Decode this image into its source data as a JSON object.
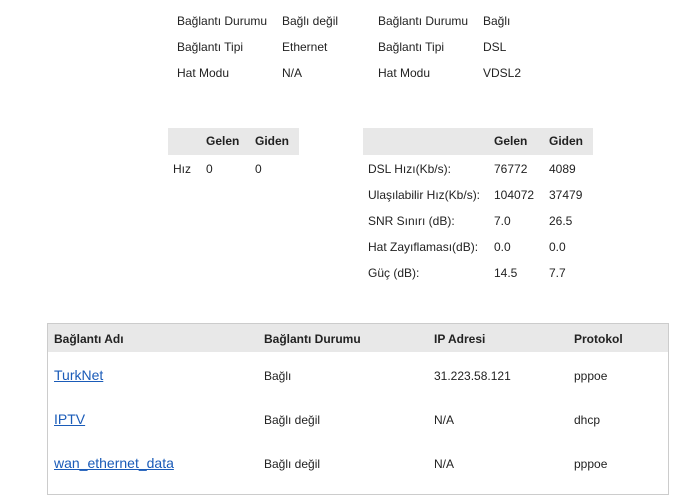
{
  "dsl_status": {
    "left": [
      {
        "label": "Bağlantı Durumu",
        "value": "Bağlı değil"
      },
      {
        "label": "Bağlantı Tipi",
        "value": "Ethernet"
      },
      {
        "label": "Hat Modu",
        "value": "N/A"
      }
    ],
    "right": [
      {
        "label": "Bağlantı Durumu",
        "value": "Bağlı"
      },
      {
        "label": "Bağlantı Tipi",
        "value": "DSL"
      },
      {
        "label": "Hat Modu",
        "value": "VDSL2"
      }
    ]
  },
  "speed_left": {
    "headers": [
      "Gelen",
      "Giden"
    ],
    "rows": [
      {
        "label": "Hız",
        "in": "0",
        "out": "0"
      }
    ]
  },
  "speed_right": {
    "headers": [
      "Gelen",
      "Giden"
    ],
    "rows": [
      {
        "label": "DSL Hızı(Kb/s):",
        "in": "76772",
        "out": "4089"
      },
      {
        "label": "Ulaşılabilir Hız(Kb/s):",
        "in": "104072",
        "out": "37479"
      },
      {
        "label": "SNR Sınırı (dB):",
        "in": "7.0",
        "out": "26.5"
      },
      {
        "label": "Hat Zayıflaması(dB):",
        "in": "0.0",
        "out": "0.0"
      },
      {
        "label": "Güç (dB):",
        "in": "14.5",
        "out": "7.7"
      }
    ]
  },
  "wan_table": {
    "headers": [
      "Bağlantı Adı",
      "Bağlantı Durumu",
      "IP Adresi",
      "Protokol"
    ],
    "rows": [
      {
        "name": "TurkNet",
        "status": "Bağlı",
        "ip": "31.223.58.121",
        "protocol": "pppoe"
      },
      {
        "name": "IPTV",
        "status": "Bağlı değil",
        "ip": "N/A",
        "protocol": "dhcp"
      },
      {
        "name": "wan_ethernet_data",
        "status": "Bağlı değil",
        "ip": "N/A",
        "protocol": "pppoe"
      }
    ]
  },
  "colors": {
    "header_bg": "#e8e8e8",
    "link": "#1a5bb8",
    "border": "#cccccc"
  }
}
